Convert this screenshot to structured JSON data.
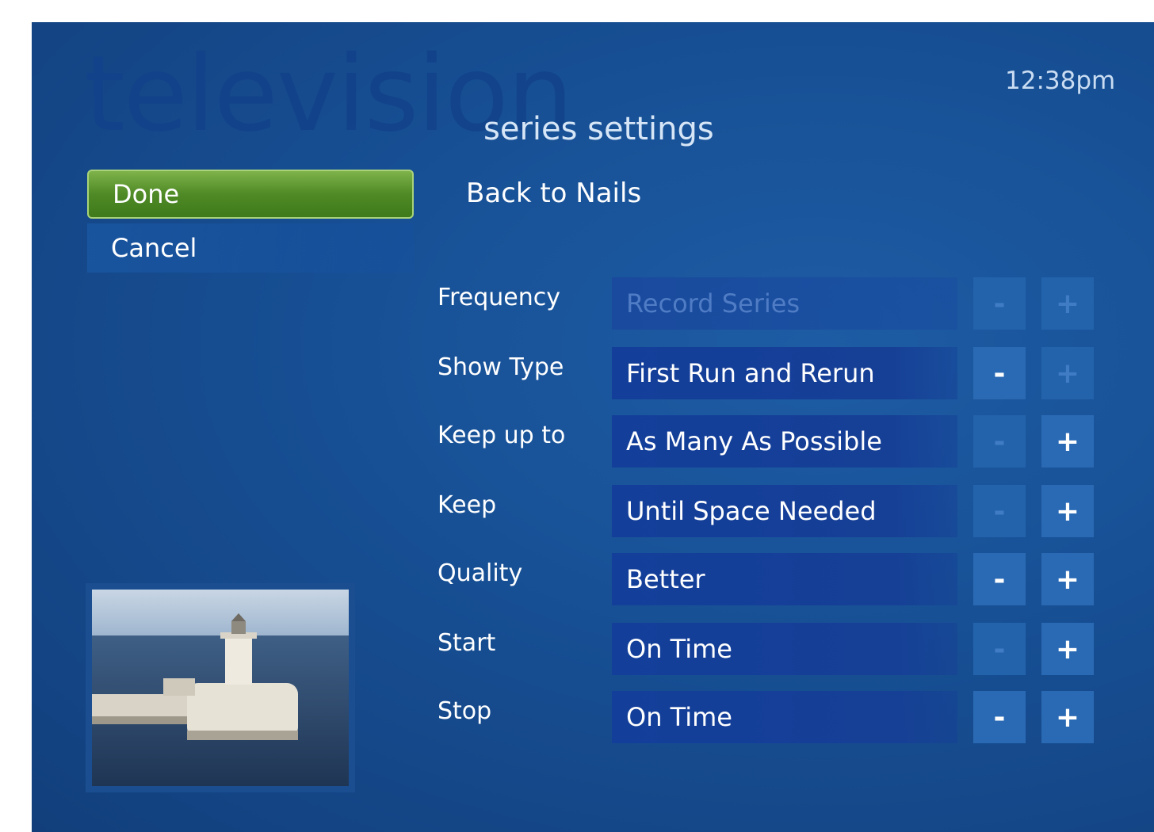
{
  "app": {
    "background_word": "television",
    "clock": "12:38pm",
    "subtitle": "series settings"
  },
  "menu": {
    "items": [
      {
        "label": "Done",
        "selected": true
      },
      {
        "label": "Cancel",
        "selected": false
      }
    ]
  },
  "back_link": "Back to Nails",
  "settings": [
    {
      "label": "Frequency",
      "value": "Record Series",
      "value_enabled": false,
      "minus_enabled": false,
      "plus_enabled": false
    },
    {
      "label": "Show Type",
      "value": "First Run and Rerun",
      "value_enabled": true,
      "minus_enabled": true,
      "plus_enabled": false
    },
    {
      "label": "Keep up to",
      "value": "As Many As Possible",
      "value_enabled": true,
      "minus_enabled": false,
      "plus_enabled": true
    },
    {
      "label": "Keep",
      "value": "Until Space Needed",
      "value_enabled": true,
      "minus_enabled": false,
      "plus_enabled": true
    },
    {
      "label": "Quality",
      "value": "Better",
      "value_enabled": true,
      "minus_enabled": true,
      "plus_enabled": true
    },
    {
      "label": "Start",
      "value": "On Time",
      "value_enabled": true,
      "minus_enabled": false,
      "plus_enabled": true
    },
    {
      "label": "Stop",
      "value": "On Time",
      "value_enabled": true,
      "minus_enabled": true,
      "plus_enabled": true
    }
  ],
  "stepper_symbols": {
    "minus": "-",
    "plus": "+"
  },
  "thumbnail": {
    "icon": "lighthouse-image"
  },
  "colors": {
    "background": "#174f94",
    "selected_green": "#4f8a26",
    "value_field": "#133f9a",
    "stepper": "#2a6ab4"
  }
}
